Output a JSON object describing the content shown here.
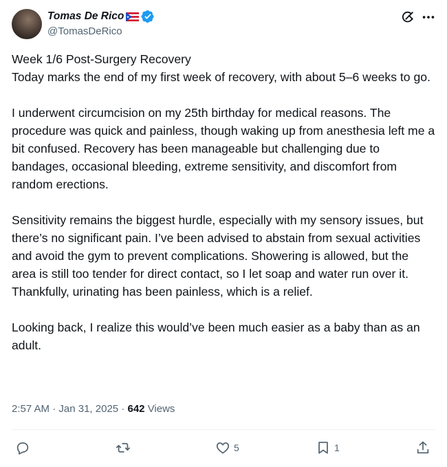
{
  "author": {
    "display_name": "Tomas De Rico",
    "handle": "@TomasDeRico"
  },
  "post": {
    "paragraphs": [
      [
        "Week 1/6 Post-Surgery Recovery",
        "Today marks the end of my first week of recovery, with about 5–6 weeks to go."
      ],
      [
        "I underwent circumcision on my 25th birthday for medical reasons. The procedure was quick and painless, though waking up from anesthesia left me a bit confused. Recovery has been manageable but challenging due to bandages, occasional bleeding, extreme sensitivity, and discomfort from random erections."
      ],
      [
        "Sensitivity remains the biggest hurdle, especially with my sensory issues, but there’s no significant pain. I’ve been advised to abstain from sexual activities and avoid the gym to prevent complications. Showering is allowed, but the area is still too tender for direct contact, so I let soap and water run over it. Thankfully, urinating has been painless, which is a relief."
      ],
      [
        "Looking back, I realize this would’ve been much easier as a baby than as an adult."
      ]
    ]
  },
  "meta": {
    "time": "2:57 AM",
    "separator": "·",
    "date": "Jan 31, 2025",
    "views_count": "642",
    "views_label": "Views"
  },
  "actions": {
    "reply_count": "",
    "repost_count": "",
    "like_count": "5",
    "bookmark_count": "1"
  },
  "colors": {
    "verified_blue": "#1d9bf0",
    "secondary_text": "#536471",
    "primary_text": "#0f1419"
  }
}
